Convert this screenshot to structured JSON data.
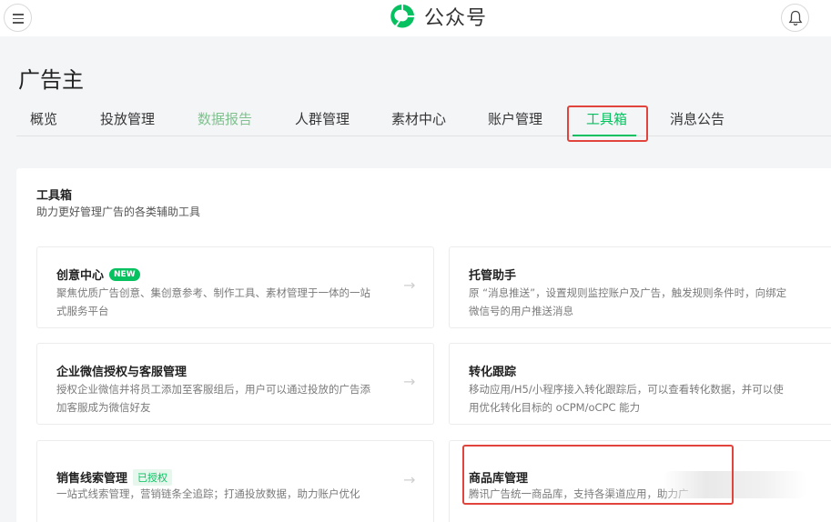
{
  "app": {
    "logo_text": "公众号"
  },
  "page": {
    "title": "广告主"
  },
  "tabs": [
    {
      "label": "概览"
    },
    {
      "label": "投放管理"
    },
    {
      "label": "数据报告"
    },
    {
      "label": "人群管理"
    },
    {
      "label": "素材中心"
    },
    {
      "label": "账户管理"
    },
    {
      "label": "工具箱"
    },
    {
      "label": "消息公告"
    }
  ],
  "toolbox": {
    "title": "工具箱",
    "description": "助力更好管理广告的各类辅助工具",
    "cards": [
      {
        "title": "创意中心",
        "badge": "NEW",
        "desc": "聚焦优质广告创意、集创意参考、制作工具、素材管理于一体的一站式服务平台"
      },
      {
        "title": "托管助手",
        "desc": "原 “消息推送”，设置规则监控账户及广告，触发规则条件时，向绑定微信号的用户推送消息"
      },
      {
        "title": "企业微信授权与客服管理",
        "desc": "授权企业微信并将员工添加至客服组后，用户可以通过投放的广告添加客服成为微信好友"
      },
      {
        "title": "转化跟踪",
        "desc": "移动应用/H5/小程序接入转化跟踪后，可以查看转化数据，并可以使用优化转化目标的 oCPM/oCPC 能力"
      },
      {
        "title": "销售线索管理",
        "badge": "已授权",
        "desc": "一站式线索管理，营销链条全追踪；打通投放数据，助力账户优化"
      },
      {
        "title": "商品库管理",
        "desc": "腾讯广告统一商品库，支持各渠道应用，助力广"
      }
    ]
  },
  "colors": {
    "accent": "#07c160",
    "highlight_box": "#e0443c"
  }
}
